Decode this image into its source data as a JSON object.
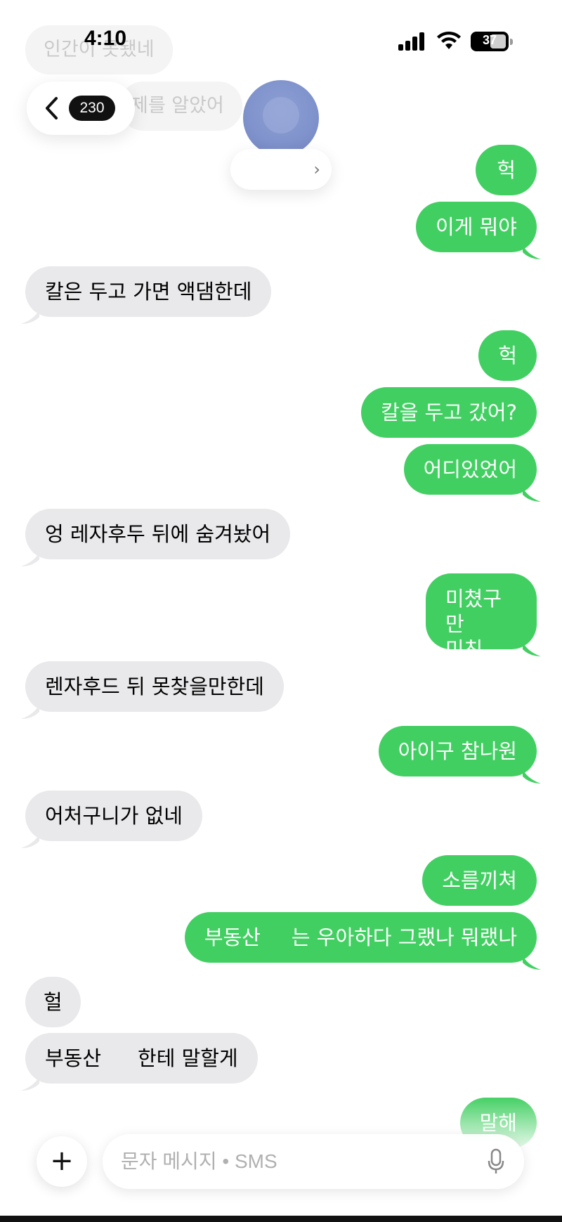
{
  "status_bar": {
    "time": "4:10",
    "battery": "37"
  },
  "header": {
    "back_count": "230",
    "contact_name": "",
    "faded_messages": [
      "인간이 못됐네",
      "제를 알았어"
    ]
  },
  "messages": [
    {
      "dir": "out",
      "text": "헉"
    },
    {
      "dir": "out",
      "text": "이게 뭐야"
    },
    {
      "dir": "in",
      "text": "칼은 두고 가면 액댐한데"
    },
    {
      "dir": "out",
      "text": "헉"
    },
    {
      "dir": "out",
      "text": "칼을 두고 갔어?"
    },
    {
      "dir": "out",
      "text": "어디있었어"
    },
    {
      "dir": "in",
      "text": "엉 레자후두 뒤에 숨겨놨어"
    },
    {
      "dir": "out",
      "line1": "미쳤구만",
      "line2": "미친"
    },
    {
      "dir": "in",
      "text": "렌자후드 뒤 못찾을만한데"
    },
    {
      "dir": "out",
      "text": "아이구 참나원"
    },
    {
      "dir": "in",
      "text": "어처구니가 없네"
    },
    {
      "dir": "out",
      "text": "소름끼쳐"
    },
    {
      "dir": "out",
      "part1": "부동산",
      "part2": "는 우아하다 그랬나 뭐랬나"
    },
    {
      "dir": "in",
      "text": "헐"
    },
    {
      "dir": "in",
      "part1": "부동산",
      "part2": "한테 말할게"
    },
    {
      "dir": "out",
      "text": "말해"
    }
  ],
  "composer": {
    "placeholder": "문자 메시지 • SMS",
    "plus_label": "+"
  },
  "colors": {
    "outgoing_bubble": "#42cf62",
    "incoming_bubble": "#e9e9eb",
    "badge": "#111111",
    "avatar": "#8093cc"
  },
  "icons": [
    "signal-icon",
    "wifi-icon",
    "battery-icon",
    "back-chevron-icon",
    "chevron-right-icon",
    "plus-icon",
    "microphone-icon"
  ]
}
